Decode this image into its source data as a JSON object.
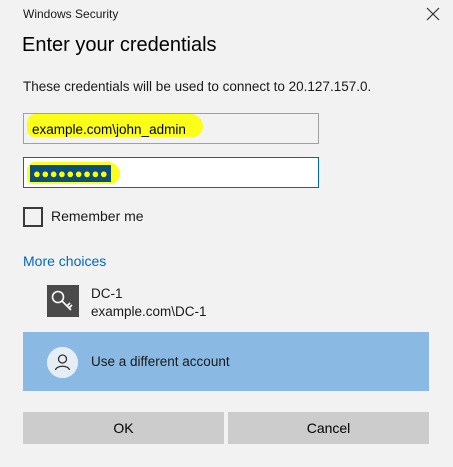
{
  "window": {
    "title": "Windows Security",
    "close_icon": "close-icon"
  },
  "heading": "Enter your credentials",
  "description": "These credentials will be used to connect to 20.127.157.0.",
  "username_field": {
    "value": "example.com\\john_admin"
  },
  "password_field": {
    "masked_value": "●●●●●●●●●"
  },
  "remember": {
    "label": "Remember me",
    "checked": false
  },
  "more_choices": "More choices",
  "accounts": [
    {
      "name": "DC-1",
      "domain": "example.com\\DC-1",
      "icon": "key-icon"
    }
  ],
  "different_account": {
    "label": "Use a different account",
    "icon": "user-icon",
    "selected": true
  },
  "buttons": {
    "ok": "OK",
    "cancel": "Cancel"
  },
  "colors": {
    "accent": "#0067c0",
    "selection": "#8ab9e3",
    "highlight": "#fbff00",
    "button": "#cccccc"
  }
}
